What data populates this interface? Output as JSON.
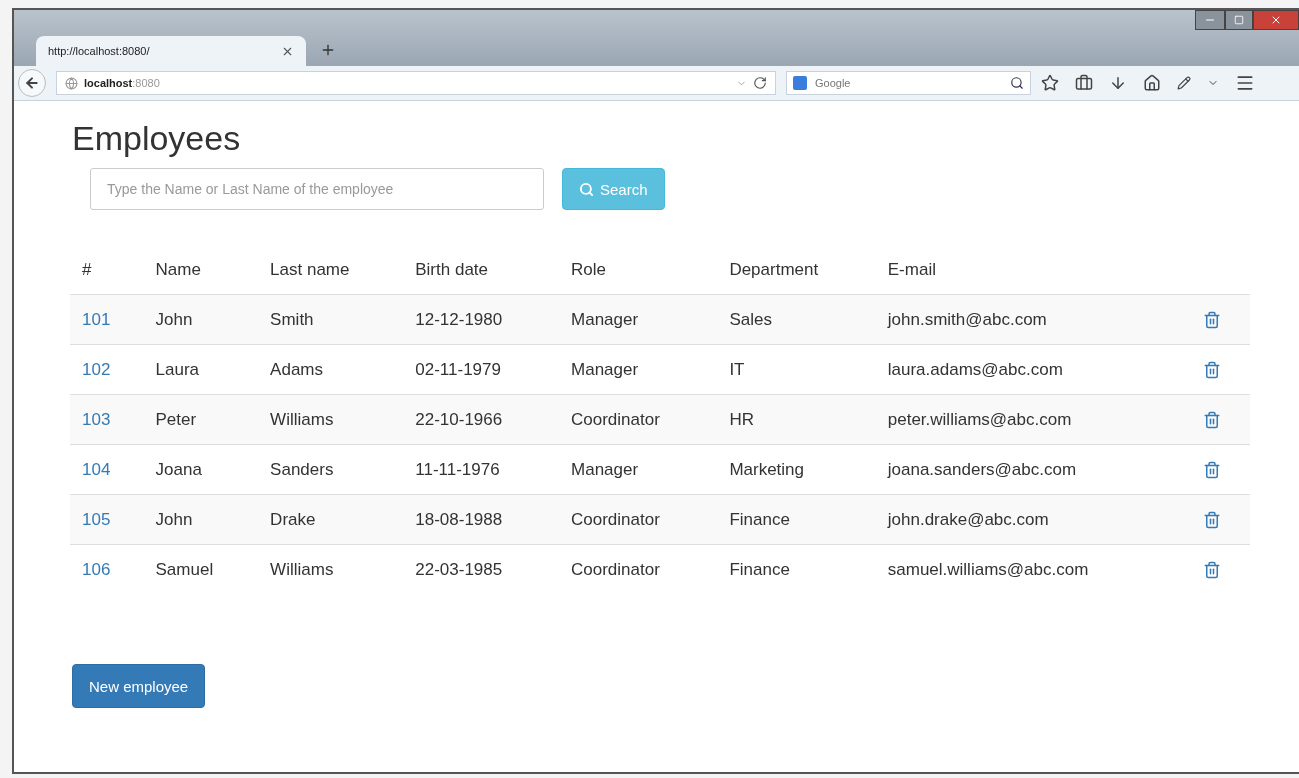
{
  "browser": {
    "tab": {
      "title": "http://localhost:8080/",
      "selected": true
    },
    "address": "**localhost**:8080",
    "search_placeholder": "Google"
  },
  "page": {
    "title": "Employees",
    "search": {
      "placeholder": "Type the Name or Last Name of the employee",
      "button": "Search"
    },
    "table": {
      "columns": [
        "#",
        "Name",
        "Last name",
        "Birth date",
        "Role",
        "Department",
        "E-mail"
      ],
      "rows": [
        {
          "id": "101",
          "name": "John",
          "last_name": "Smith",
          "birth_date": "12-12-1980",
          "role": "Manager",
          "department": "Sales",
          "email": "john.smith@abc.com"
        },
        {
          "id": "102",
          "name": "Laura",
          "last_name": "Adams",
          "birth_date": "02-11-1979",
          "role": "Manager",
          "department": "IT",
          "email": "laura.adams@abc.com"
        },
        {
          "id": "103",
          "name": "Peter",
          "last_name": "Williams",
          "birth_date": "22-10-1966",
          "role": "Coordinator",
          "department": "HR",
          "email": "peter.williams@abc.com"
        },
        {
          "id": "104",
          "name": "Joana",
          "last_name": "Sanders",
          "birth_date": "11-11-1976",
          "role": "Manager",
          "department": "Marketing",
          "email": "joana.sanders@abc.com"
        },
        {
          "id": "105",
          "name": "John",
          "last_name": "Drake",
          "birth_date": "18-08-1988",
          "role": "Coordinator",
          "department": "Finance",
          "email": "john.drake@abc.com"
        },
        {
          "id": "106",
          "name": "Samuel",
          "last_name": "Williams",
          "birth_date": "22-03-1985",
          "role": "Coordinator",
          "department": "Finance",
          "email": "samuel.williams@abc.com"
        }
      ]
    },
    "new_button": "New employee"
  }
}
